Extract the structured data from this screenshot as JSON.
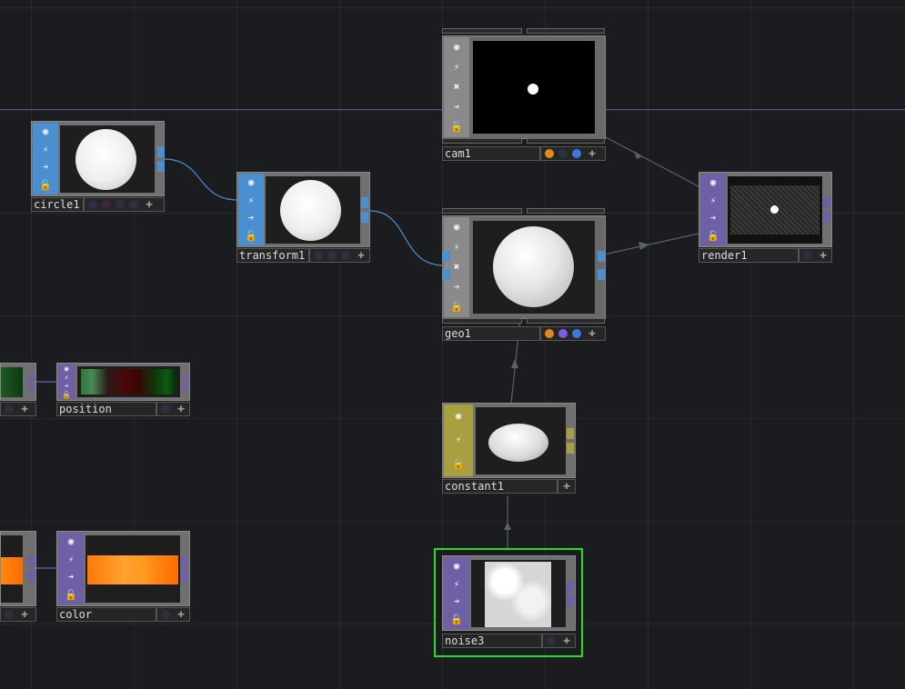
{
  "canvas": {
    "background": "#1b1c20",
    "grid_color": "#2a2b30"
  },
  "nodes": {
    "circle1": {
      "label": "circle1",
      "family": "SOP",
      "color": "#4a8fd0"
    },
    "transform1": {
      "label": "transform1",
      "family": "SOP",
      "color": "#4a8fd0"
    },
    "cam1": {
      "label": "cam1",
      "family": "COMP",
      "color": "#8a8a8a"
    },
    "geo1": {
      "label": "geo1",
      "family": "COMP",
      "color": "#8a8a8a"
    },
    "render1": {
      "label": "render1",
      "family": "TOP",
      "color": "#6e5fa6"
    },
    "position": {
      "label": "position",
      "family": "TOP",
      "color": "#6e5fa6"
    },
    "color": {
      "label": "color",
      "family": "TOP",
      "color": "#6e5fa6"
    },
    "constant1": {
      "label": "constant1",
      "family": "MAT",
      "color": "#a8a040"
    },
    "noise3": {
      "label": "noise3",
      "family": "TOP",
      "color": "#6e5fa6",
      "selected": true
    }
  },
  "flag_colors": {
    "orange": "#e08a20",
    "purple": "#7a5fe0",
    "blue": "#3a7ae0",
    "off": "#2b3140"
  },
  "selection_color": "#22dd22",
  "icons": [
    "viewer-icon",
    "bypass-icon",
    "cook-icon",
    "display-icon",
    "lock-icon",
    "plus-icon"
  ]
}
